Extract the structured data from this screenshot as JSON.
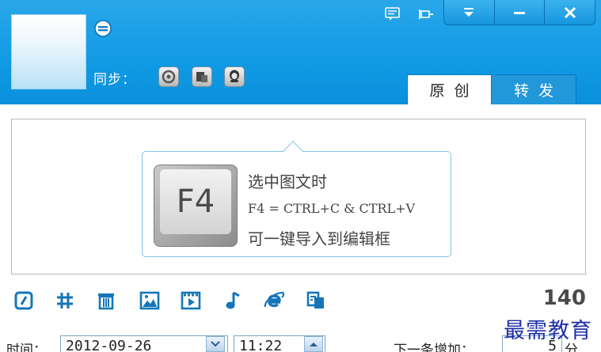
{
  "header": {
    "sync_label": "同步：",
    "tabs": [
      {
        "label": "原创",
        "active": true
      },
      {
        "label": "转发",
        "active": false
      }
    ]
  },
  "editor": {
    "hint": {
      "key_label": "F4",
      "line1": "选中图文时",
      "line2": "F4 = CTRL+C & CTRL+V",
      "line3": "可一键导入到编辑框"
    }
  },
  "toolbar": {
    "char_count": "140",
    "icons": [
      "emoticon-icon",
      "hashtag-icon",
      "trash-icon",
      "image-icon",
      "video-icon",
      "music-icon",
      "ie-icon",
      "copy-icon"
    ]
  },
  "schedule": {
    "time_label": "时间：",
    "date_value": "2012-09-26",
    "time_value": "11:22",
    "increment_label": "下一条增加：",
    "increment_value": "5",
    "increment_unit": "分"
  },
  "watermark": "最需教育",
  "colors": {
    "header_blue": "#109ae4",
    "hint_border": "#7fc4e6",
    "watermark": "#1e2fa6"
  }
}
